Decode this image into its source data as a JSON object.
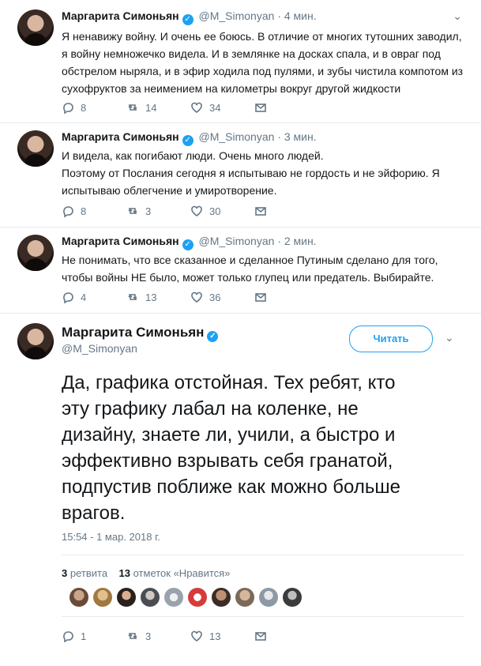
{
  "tweets": [
    {
      "name": "Маргарита Симоньян",
      "handle": "@M_Simonyan",
      "time": "4 мин.",
      "lines": [
        "Я ненавижу войну. И очень ее боюсь. В отличие от многих тутошних заводил,",
        "я войну немножечко видела. И в землянке на досках спала, и в овраг под",
        "обстрелом ныряла, и в эфир ходила под пулями, и зубы чистила компотом из",
        "сухофруктов за неимением на километры вокруг другой жидкости"
      ],
      "replies": "8",
      "retweets": "14",
      "likes": "34"
    },
    {
      "name": "Маргарита Симоньян",
      "handle": "@M_Simonyan",
      "time": "3 мин.",
      "lines": [
        "И видела, как погибают люди. Очень много людей.",
        "Поэтому от Послания сегодня я испытываю не гордость и не эйфорию. Я",
        "испытываю облегчение и умиротворение."
      ],
      "replies": "8",
      "retweets": "3",
      "likes": "30"
    },
    {
      "name": "Маргарита Симоньян",
      "handle": "@M_Simonyan",
      "time": "2 мин.",
      "lines": [
        "Не понимать, что все сказанное и сделанное Путиным сделано для того,",
        "чтобы войны НЕ было, может только глупец или предатель. Выбирайте."
      ],
      "replies": "4",
      "retweets": "13",
      "likes": "36"
    }
  ],
  "main": {
    "name": "Маргарита Симоньян",
    "handle": "@M_Simonyan",
    "follow_label": "Читать",
    "lines": [
      "Да, графика отстойная. Тех ребят, кто",
      "эту графику лабал на коленке, не",
      "дизайну, знаете ли, учили, а быстро и",
      "эффективно взрывать себя гранатой,",
      "подпустив поближе как можно больше",
      "врагов."
    ],
    "timestamp": "15:54 - 1 мар. 2018 г.",
    "retweet_count": "3",
    "retweet_label": "ретвита",
    "like_count": "13",
    "like_label": "отметок «Нравится»",
    "replies": "1",
    "retweets": "3",
    "likes": "13"
  },
  "colors": {
    "accent": "#1da1f2",
    "text": "#14171a",
    "muted": "#657786",
    "divider": "#e6ecf0"
  },
  "icons": [
    "reply-icon",
    "retweet-icon",
    "like-icon",
    "message-icon",
    "verified-icon",
    "chevron-down-icon"
  ]
}
